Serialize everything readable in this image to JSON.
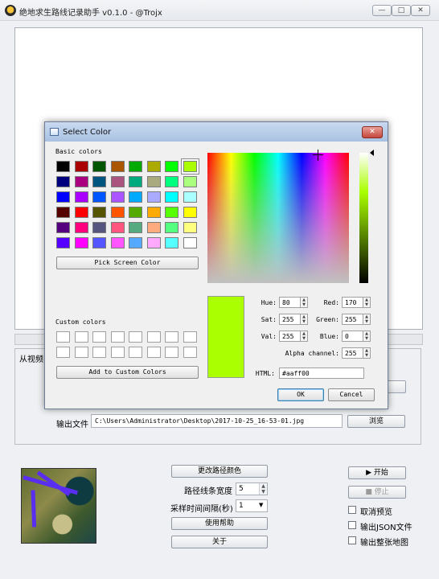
{
  "window": {
    "title": "绝地求生路线记录助手 v0.1.0 - @Trojx",
    "minimize": "—",
    "maximize": "□",
    "close": "✕"
  },
  "tab": {
    "label": "从视频"
  },
  "output": {
    "label": "输出文件",
    "path": "C:\\Users\\Administrator\\Desktop\\2017-10-25_16-53-01.jpg",
    "browse": "浏览"
  },
  "controls": {
    "change_color": "更改路径颜色",
    "line_width_label": "路径线条宽度",
    "line_width_value": "5",
    "interval_label": "采样时间间隔(秒)",
    "interval_value": "1",
    "help": "使用帮助",
    "about": "关于",
    "start": "▶ 开始",
    "stop": "■ 停止",
    "cancel_preview": "取消预览",
    "export_json": "输出JSON文件",
    "export_full_map": "输出整张地图"
  },
  "dialog": {
    "title": "Select Color",
    "close": "✕",
    "basic_colors_label": "Basic colors",
    "custom_colors_label": "Custom colors",
    "pick_screen": "Pick Screen Color",
    "add_custom": "Add to Custom Colors",
    "basic_colors": [
      "#000000",
      "#aa0000",
      "#005500",
      "#aa5500",
      "#00aa00",
      "#aaaa00",
      "#00ff00",
      "#aaff00",
      "#00007f",
      "#aa007f",
      "#00557f",
      "#aa557f",
      "#00aa7f",
      "#aaaa7f",
      "#00ff7f",
      "#aaff7f",
      "#0000ff",
      "#aa00ff",
      "#0055ff",
      "#aa55ff",
      "#00aaff",
      "#aaaaff",
      "#00ffff",
      "#aaffff",
      "#550000",
      "#ff0000",
      "#555500",
      "#ff5500",
      "#55aa00",
      "#ffaa00",
      "#55ff00",
      "#ffff00",
      "#55007f",
      "#ff007f",
      "#55557f",
      "#ff557f",
      "#55aa7f",
      "#ffaa7f",
      "#55ff7f",
      "#ffff7f",
      "#5500ff",
      "#ff00ff",
      "#5555ff",
      "#ff55ff",
      "#55aaff",
      "#ffaaff",
      "#55ffff",
      "#ffffff"
    ],
    "selected_color": "#aaff00",
    "hue_label": "Hue:",
    "hue": "80",
    "sat_label": "Sat:",
    "sat": "255",
    "val_label": "Val:",
    "val": "255",
    "red_label": "Red:",
    "red": "170",
    "green_label": "Green:",
    "green": "255",
    "blue_label": "Blue:",
    "blue": "0",
    "alpha_label": "Alpha channel:",
    "alpha": "255",
    "html_label": "HTML:",
    "html": "#aaff00",
    "ok": "OK",
    "cancel": "Cancel"
  }
}
